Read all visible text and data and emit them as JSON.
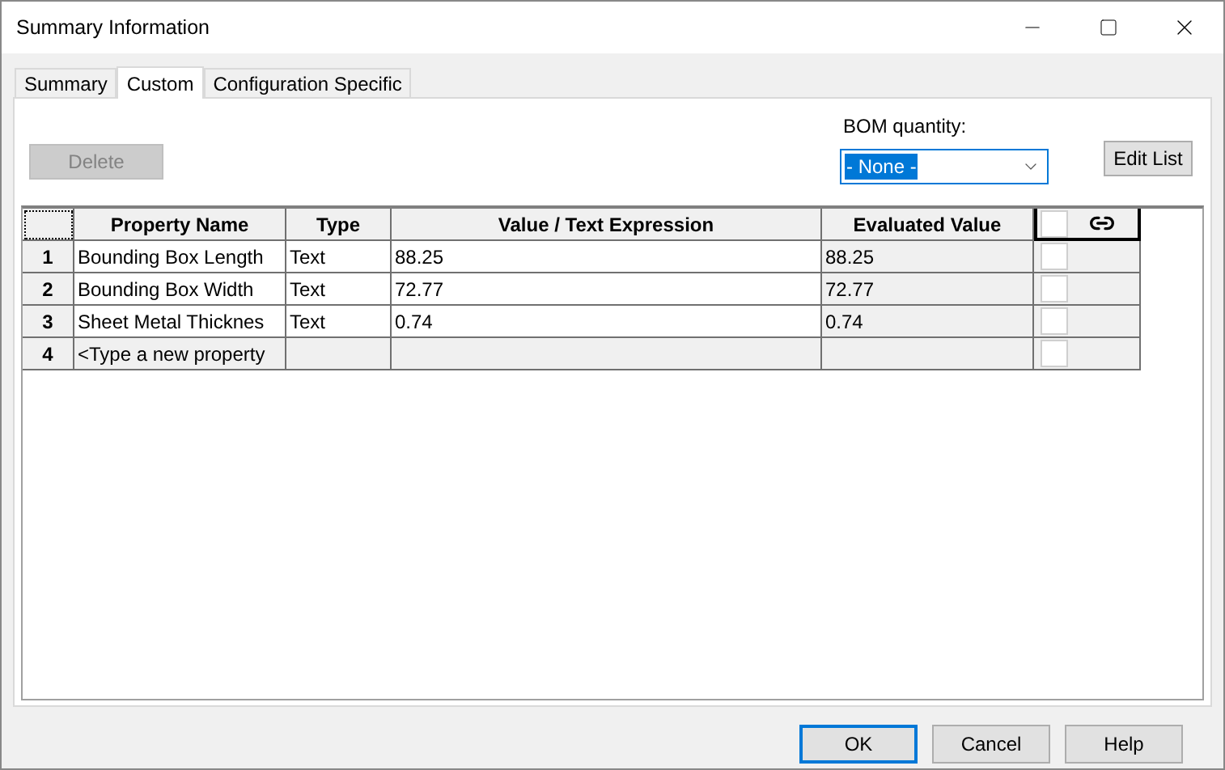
{
  "window": {
    "title": "Summary Information"
  },
  "tabs": [
    {
      "label": "Summary",
      "selected": false
    },
    {
      "label": "Custom",
      "selected": true
    },
    {
      "label": "Configuration Specific",
      "selected": false
    }
  ],
  "delete_button": {
    "label": "Delete",
    "disabled": true
  },
  "bom_quantity": {
    "label": "BOM quantity:",
    "value": "- None -"
  },
  "edit_list_button": {
    "label": "Edit List"
  },
  "table": {
    "columns": [
      "Property Name",
      "Type",
      "Value / Text Expression",
      "Evaluated Value"
    ],
    "header_checked": false,
    "rows": [
      {
        "number": "1",
        "name": "Bounding Box Length",
        "type": "Text",
        "value": "88.25",
        "evaluated": "88.25",
        "checked": false
      },
      {
        "number": "2",
        "name": "Bounding Box Width",
        "type": "Text",
        "value": "72.77",
        "evaluated": "72.77",
        "checked": false
      },
      {
        "number": "3",
        "name": "Sheet Metal Thicknes",
        "type": "Text",
        "value": "0.74",
        "evaluated": "0.74",
        "checked": false
      }
    ],
    "new_row": {
      "number": "4",
      "placeholder": "<Type a new property",
      "checked": false
    }
  },
  "buttons": [
    {
      "label": "OK",
      "default": true
    },
    {
      "label": "Cancel",
      "default": false
    },
    {
      "label": "Help",
      "default": false
    }
  ]
}
